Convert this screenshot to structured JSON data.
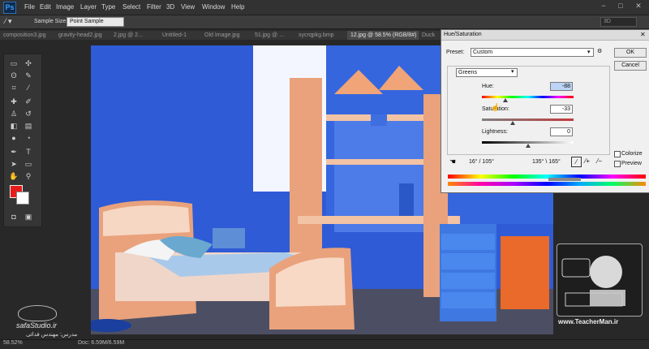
{
  "app": {
    "logo": "Ps"
  },
  "menu": [
    "File",
    "Edit",
    "Image",
    "Layer",
    "Type",
    "Select",
    "Filter",
    "3D",
    "View",
    "Window",
    "Help"
  ],
  "window_controls": {
    "minimize": "−",
    "maximize": "□",
    "close": "✕"
  },
  "options_bar": {
    "sample_size_label": "Sample Size:",
    "sample_size_value": "Point Sample",
    "workspace_value": "3D"
  },
  "tabs": [
    "composition3.jpg",
    "gravity-head2.jpg",
    "2.jpg @ 2...",
    "Untitled-1",
    "Old Image.jpg",
    "51.jpg @ ...",
    "xycrqpkg.bmp",
    "12.jpg @ 58.5% (RGB/8#)",
    "Duck"
  ],
  "status": {
    "zoom": "58.52%",
    "doc": "Doc: 6.59M/6.59M"
  },
  "watermarks": {
    "left_site": "safaStudio.ir",
    "left_name": "مدرس: مهندس فدائی",
    "right_site": "www.TeacherMan.ir"
  },
  "dialog": {
    "title": "Hue/Saturation",
    "preset_label": "Preset:",
    "preset_value": "Custom",
    "channel_value": "Greens",
    "hue_label": "Hue:",
    "hue_value": "-88",
    "saturation_label": "Saturation:",
    "saturation_value": "-33",
    "lightness_label": "Lightness:",
    "lightness_value": "0",
    "range_left": "16° / 105°",
    "range_right": "135° \\ 165°",
    "ok_label": "OK",
    "cancel_label": "Cancel",
    "colorize_label": "Colorize",
    "preview_label": "Preview",
    "colorize_checked": false,
    "preview_checked": true,
    "hue_level": -88,
    "saturation_level": -33,
    "lightness_level": 0
  },
  "colors": {
    "foreground": "#e61c1c",
    "background": "#ffffff",
    "wall": "#2f5bd6",
    "furniture": "#e9a27c"
  }
}
